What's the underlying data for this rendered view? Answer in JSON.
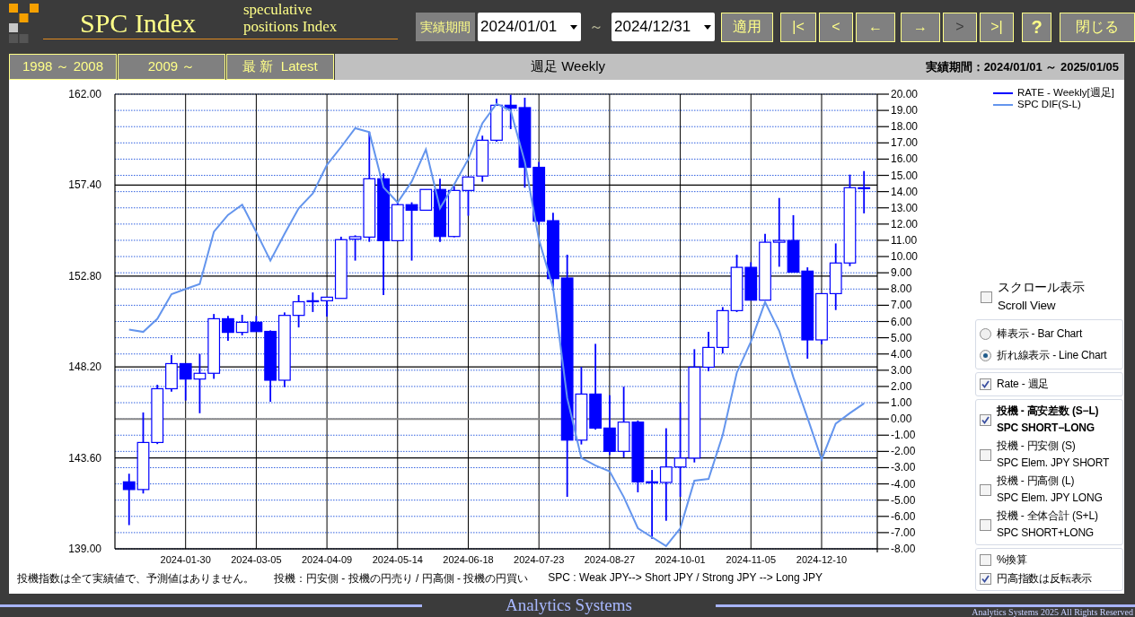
{
  "header": {
    "title": "SPC Index",
    "subtitle_lines": [
      "speculative",
      "positions Index"
    ]
  },
  "period": {
    "label": "実績期間",
    "from": "2024/01/01",
    "separator": "～",
    "to": "2024/12/31",
    "apply": "適用"
  },
  "nav_buttons": [
    {
      "label": "|<",
      "disabled": false
    },
    {
      "label": "<",
      "disabled": false
    },
    {
      "label": "←",
      "disabled": false
    },
    {
      "label": "→",
      "disabled": false
    },
    {
      "label": ">",
      "disabled": true
    },
    {
      "label": ">|",
      "disabled": false
    }
  ],
  "help_button": "?",
  "close_button": "閉じる",
  "range_tabs": [
    {
      "label": "1998 ～ 2008"
    },
    {
      "label": "2009 ～"
    },
    {
      "label": "最 新  Latest"
    }
  ],
  "chart_title": "週足 Weekly",
  "period_info": "実績期間：2024/01/01 ～ 2025/01/05",
  "chart": {
    "chart_data": {
      "type": "candlestick",
      "categories": [
        null,
        null,
        null,
        null,
        "2024-01-30",
        null,
        null,
        null,
        null,
        "2024-03-05",
        null,
        null,
        null,
        null,
        "2024-04-09",
        null,
        null,
        null,
        null,
        "2024-05-14",
        null,
        null,
        null,
        null,
        "2024-06-18",
        null,
        null,
        null,
        null,
        "2024-07-23",
        null,
        null,
        null,
        null,
        "2024-08-27",
        null,
        null,
        null,
        null,
        "2024-10-01",
        null,
        null,
        null,
        null,
        "2024-11-05",
        null,
        null,
        null,
        null,
        "2024-12-10",
        null,
        null,
        null
      ],
      "grid": true,
      "ylim": [
        139,
        162
      ],
      "y2lim": [
        -8,
        20
      ],
      "yticks": [
        {
          "value": 162,
          "label": "162.00"
        },
        {
          "value": 157.4,
          "label": "157.40"
        },
        {
          "value": 152.8,
          "label": "152.80"
        },
        {
          "value": 148.2,
          "label": "148.20"
        },
        {
          "value": 143.6,
          "label": "143.60"
        },
        {
          "value": 139,
          "label": "139.00"
        }
      ],
      "y2ticks": [
        {
          "value": 20,
          "label": "20.00"
        },
        {
          "value": 19,
          "label": "19.00"
        },
        {
          "value": 18,
          "label": "18.00"
        },
        {
          "value": 17,
          "label": "17.00"
        },
        {
          "value": 16,
          "label": "16.00"
        },
        {
          "value": 15,
          "label": "15.00"
        },
        {
          "value": 14,
          "label": "14.00"
        },
        {
          "value": 13,
          "label": "13.00"
        },
        {
          "value": 12,
          "label": "12.00"
        },
        {
          "value": 11,
          "label": "11.00"
        },
        {
          "value": 10,
          "label": "10.00"
        },
        {
          "value": 9,
          "label": "9.00"
        },
        {
          "value": 8,
          "label": "8.00"
        },
        {
          "value": 7,
          "label": "7.00"
        },
        {
          "value": 6,
          "label": "6.00"
        },
        {
          "value": 5,
          "label": "5.00"
        },
        {
          "value": 4,
          "label": "4.00"
        },
        {
          "value": 3,
          "label": "3.00"
        },
        {
          "value": 2,
          "label": "2.00"
        },
        {
          "value": 1,
          "label": "1.00"
        },
        {
          "value": 0,
          "label": "0.00"
        },
        {
          "value": -1,
          "label": "-1.00"
        },
        {
          "value": -2,
          "label": "-2.00"
        },
        {
          "value": -3,
          "label": "-3.00"
        },
        {
          "value": -4,
          "label": "-4.00"
        },
        {
          "value": -5,
          "label": "-5.00"
        },
        {
          "value": -6,
          "label": "-6.00"
        },
        {
          "value": -7,
          "label": "-7.00"
        },
        {
          "value": -8,
          "label": "-8.00"
        }
      ],
      "series": [
        {
          "name": "RATE - Weekly[週足]",
          "color": "#0000ff",
          "ohlc": [
            [
              142.39,
              142.8,
              140.2,
              142.0
            ],
            [
              142.0,
              145.9,
              141.8,
              144.38
            ],
            [
              144.38,
              147.3,
              144.3,
              147.1
            ],
            [
              147.1,
              148.8,
              146.95,
              148.37
            ],
            [
              148.37,
              148.37,
              146.5,
              147.59
            ],
            [
              147.59,
              148.86,
              145.86,
              147.88
            ],
            [
              147.88,
              150.88,
              147.6,
              150.64
            ],
            [
              150.64,
              150.78,
              149.52,
              149.95
            ],
            [
              149.95,
              150.84,
              149.8,
              150.46
            ],
            [
              150.46,
              150.78,
              149.99,
              149.99
            ],
            [
              150.0,
              150.05,
              146.44,
              147.53
            ],
            [
              147.53,
              150.96,
              147.18,
              150.81
            ],
            [
              150.81,
              151.84,
              150.2,
              151.5
            ],
            [
              151.5,
              151.97,
              150.98,
              151.55
            ],
            [
              151.55,
              151.73,
              150.75,
              151.73
            ],
            [
              151.67,
              154.79,
              151.67,
              154.64
            ],
            [
              154.67,
              154.86,
              153.58,
              154.79
            ],
            [
              154.77,
              160.1,
              154.53,
              157.72
            ],
            [
              157.72,
              158.0,
              151.84,
              154.59
            ],
            [
              154.59,
              156.53,
              154.59,
              156.41
            ],
            [
              156.41,
              156.53,
              153.58,
              156.13
            ],
            [
              156.13,
              157.18,
              156.13,
              157.18
            ],
            [
              157.18,
              157.72,
              154.53,
              154.8
            ],
            [
              154.8,
              157.36,
              154.76,
              157.13
            ],
            [
              157.13,
              157.81,
              155.85,
              157.81
            ],
            [
              157.86,
              159.9,
              157.57,
              159.67
            ],
            [
              159.67,
              161.77,
              159.6,
              161.44
            ],
            [
              161.44,
              161.97,
              160.23,
              161.29
            ],
            [
              161.32,
              161.82,
              157.27,
              158.3
            ],
            [
              158.3,
              158.57,
              155.4,
              155.57
            ],
            [
              155.6,
              156.0,
              152.07,
              152.67
            ],
            [
              152.7,
              153.88,
              141.63,
              144.5
            ],
            [
              144.5,
              148.2,
              144.28,
              146.83
            ],
            [
              146.83,
              149.37,
              145.03,
              145.11
            ],
            [
              145.11,
              146.77,
              143.75,
              143.93
            ],
            [
              143.93,
              147.2,
              143.63,
              145.41
            ],
            [
              145.41,
              145.49,
              141.86,
              142.39
            ],
            [
              142.39,
              142.99,
              139.51,
              142.36
            ],
            [
              142.36,
              145.1,
              140.42,
              143.14
            ],
            [
              143.14,
              146.4,
              141.63,
              143.59
            ],
            [
              143.59,
              149.1,
              143.37,
              148.19
            ],
            [
              148.19,
              149.98,
              147.98,
              149.19
            ],
            [
              149.19,
              151.23,
              148.89,
              151.05
            ],
            [
              151.05,
              153.88,
              150.98,
              153.24
            ],
            [
              153.24,
              153.5,
              151.58,
              151.58
            ],
            [
              151.58,
              154.94,
              151.58,
              154.51
            ],
            [
              154.51,
              156.75,
              153.27,
              154.6
            ],
            [
              154.6,
              155.88,
              153.0,
              153.0
            ],
            [
              153.05,
              153.24,
              148.62,
              149.57
            ],
            [
              149.57,
              151.91,
              149.34,
              151.91
            ],
            [
              151.91,
              154.45,
              151.08,
              153.46
            ],
            [
              153.46,
              157.93,
              153.3,
              157.27
            ],
            [
              157.27,
              158.11,
              155.97,
              157.22
            ]
          ]
        },
        {
          "name": "SPC DIF(S-L)",
          "color": "#6495ed",
          "type": "line",
          "axis": "y2",
          "values": [
            5.5,
            5.36,
            6.16,
            7.68,
            8.0,
            8.31,
            11.53,
            12.56,
            13.19,
            11.5,
            9.75,
            11.4,
            12.97,
            13.89,
            15.64,
            16.74,
            17.9,
            17.66,
            14.26,
            13.33,
            14.62,
            16.59,
            12.97,
            14.44,
            16.0,
            18.21,
            19.41,
            18.99,
            15.82,
            11.03,
            8.09,
            1.28,
            -2.4,
            -2.87,
            -3.23,
            -4.8,
            -6.73,
            -7.28,
            -7.83,
            -6.73,
            -3.8,
            -3.69,
            -1.0,
            2.84,
            4.77,
            7.2,
            5.42,
            2.57,
            0.08,
            -2.5,
            -0.29,
            0.36,
            0.95
          ]
        }
      ]
    }
  },
  "notes": [
    "投機指数は全て実績値で、予測値はありません。",
    "投機：円安側 - 投機の円売り / 円高側 - 投機の円買い",
    "SPC : Weak JPY--> Short JPY / Strong JPY --> Long JPY"
  ],
  "options": {
    "scroll": {
      "label": "スクロール表示",
      "sublabel": "Scroll View",
      "checked": false
    },
    "chart_mode": [
      {
        "label": "棒表示 - Bar Chart",
        "selected": false
      },
      {
        "label": "折れ線表示 - Line Chart",
        "selected": true
      }
    ],
    "rate": {
      "label": "Rate - 週足",
      "checked": true
    },
    "series_toggles": [
      {
        "label": "投機 - 高安差数 (S−L)",
        "sublabel": "SPC  SHORT−LONG",
        "checked": true
      },
      {
        "label": "投機 - 円安側 (S)",
        "sublabel": "SPC Elem. JPY SHORT",
        "checked": false
      },
      {
        "label": "投機 - 円高側 (L)",
        "sublabel": "SPC Elem. JPY LONG",
        "checked": false
      },
      {
        "label": "投機 - 全体合計 (S+L)",
        "sublabel": "SPC  SHORT+LONG",
        "checked": false
      }
    ],
    "display": [
      {
        "label": "%換算",
        "checked": false
      },
      {
        "label": "円高指数は反転表示",
        "checked": true
      }
    ]
  },
  "footer": {
    "brand": "Analytics Systems",
    "copyright": "Analytics Systems 2025 All Rights Reserved"
  }
}
